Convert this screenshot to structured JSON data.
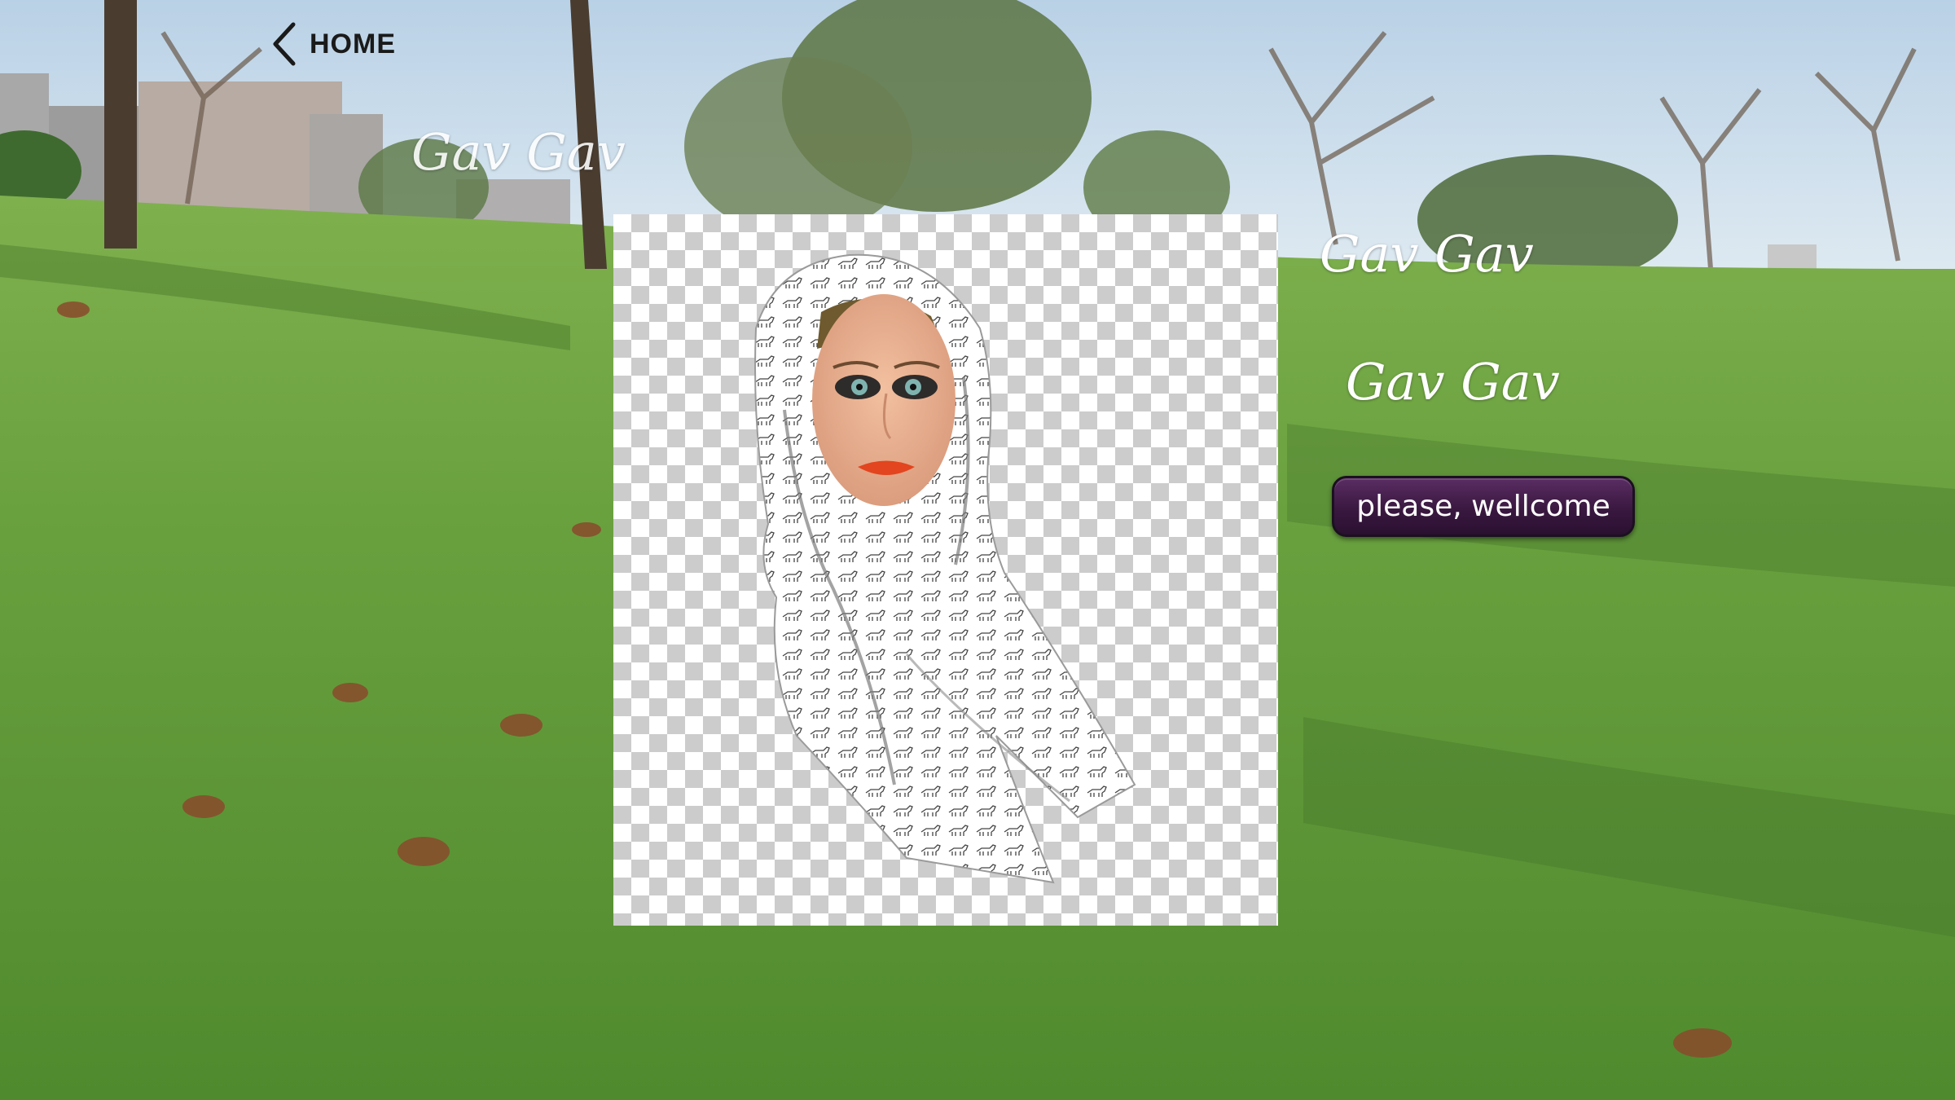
{
  "nav": {
    "home_label": "HOME",
    "back_icon": "chevron-left-icon"
  },
  "captions": [
    "Gav Gav",
    "Gav Gav",
    "Gav Gav"
  ],
  "welcome_button": {
    "label": "please, wellcome",
    "color": "#3a1840"
  },
  "image": {
    "description_icon": "hooded-face-image"
  },
  "colors": {
    "grass": "#5f9a3a",
    "sky": "#cfe0ee",
    "button": "#3a1840",
    "checker": "#cccccc"
  }
}
